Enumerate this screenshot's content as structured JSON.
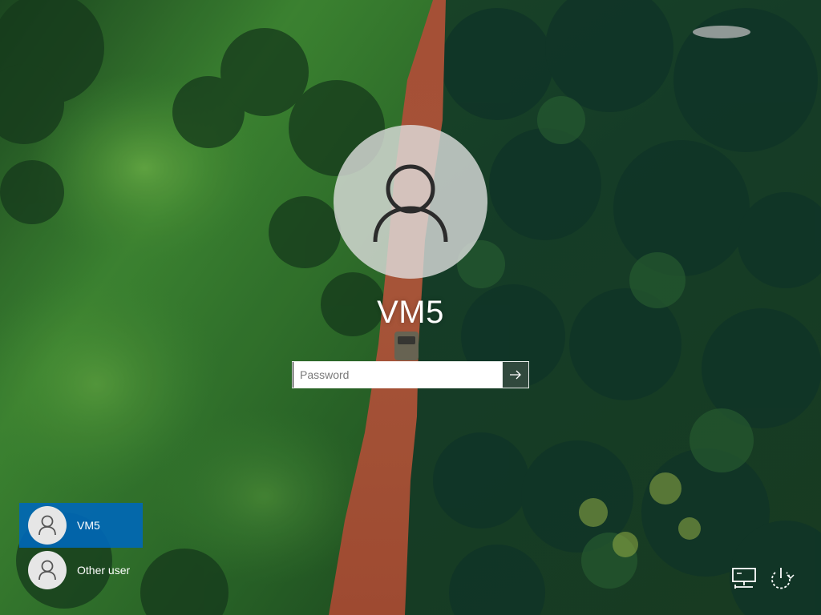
{
  "login": {
    "user_name": "VM5",
    "password_placeholder": "Password",
    "password_value": ""
  },
  "users": [
    {
      "label": "VM5",
      "selected": true
    },
    {
      "label": "Other user",
      "selected": false
    }
  ],
  "icons": {
    "big_avatar": "user-icon",
    "submit": "arrow-right-icon",
    "tile_avatar": "user-icon",
    "network": "network-icon",
    "power": "power-icon"
  },
  "colors": {
    "selected_tile": "#0067b8",
    "submit_button": "#3c5046",
    "text": "#ffffff"
  }
}
